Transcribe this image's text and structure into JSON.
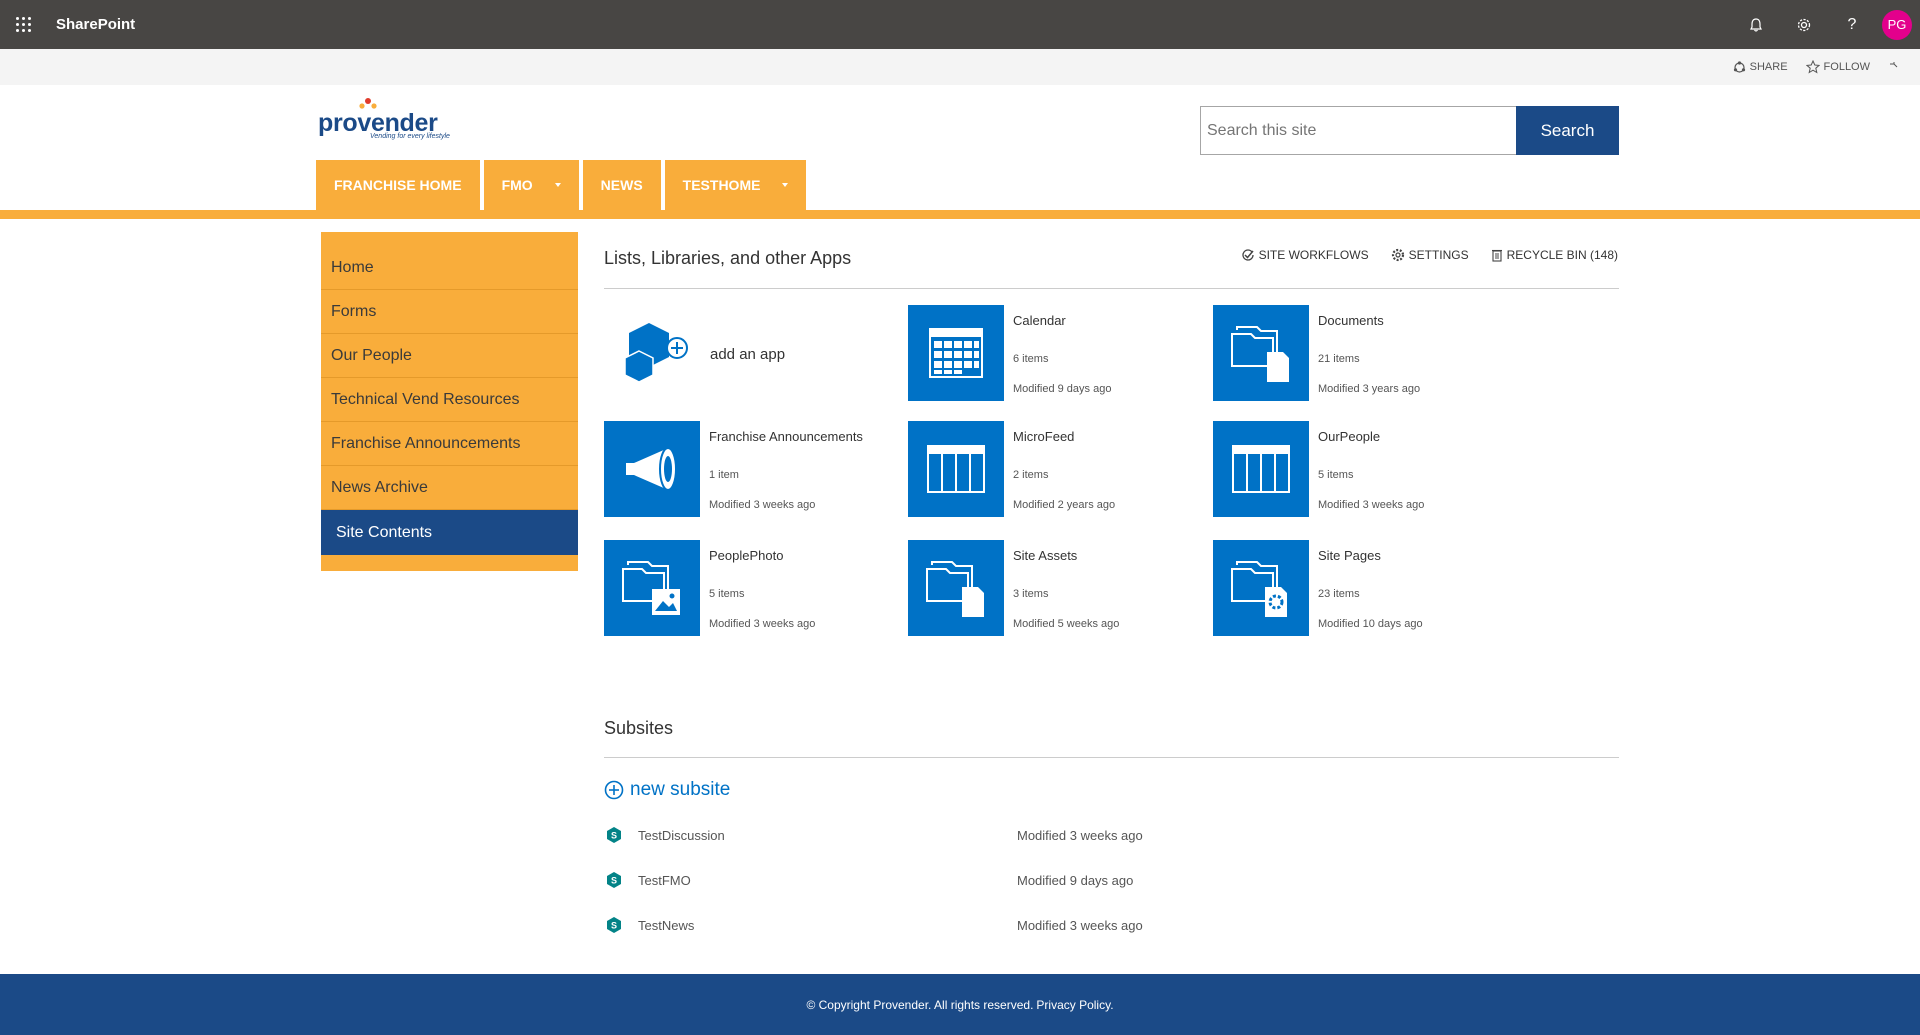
{
  "suitebar": {
    "brand": "SharePoint",
    "avatar_initials": "PG",
    "avatar_color": "#e3008c"
  },
  "actionbar": {
    "share": "SHARE",
    "follow": "FOLLOW"
  },
  "header": {
    "logo_text": "provender",
    "logo_tagline": "Vending for every lifestyle",
    "search_placeholder": "Search this site",
    "search_button": "Search"
  },
  "topnav": [
    {
      "label": "FRANCHISE HOME",
      "has_dropdown": false
    },
    {
      "label": "FMO",
      "has_dropdown": true
    },
    {
      "label": "NEWS",
      "has_dropdown": false
    },
    {
      "label": "TESTHOME",
      "has_dropdown": true
    }
  ],
  "leftnav": [
    {
      "label": "Home"
    },
    {
      "label": "Forms"
    },
    {
      "label": "Our People"
    },
    {
      "label": "Technical Vend Resources"
    },
    {
      "label": "Franchise Announcements"
    },
    {
      "label": "News Archive"
    },
    {
      "label": "Site Contents",
      "selected": true
    }
  ],
  "main": {
    "title": "Lists, Libraries, and other Apps",
    "site_workflows": "SITE WORKFLOWS",
    "settings": "SETTINGS",
    "recycle_bin": "RECYCLE BIN (148)",
    "add_app": "add an app",
    "tiles": [
      {
        "name": "Calendar",
        "count": "6 items",
        "modified": "Modified 9 days ago",
        "icon": "calendar-icon"
      },
      {
        "name": "Documents",
        "count": "21 items",
        "modified": "Modified 3 years ago",
        "icon": "document-library-icon"
      },
      {
        "name": "Franchise Announcements",
        "count": "1 item",
        "modified": "Modified 3 weeks ago",
        "icon": "megaphone-icon"
      },
      {
        "name": "MicroFeed",
        "count": "2 items",
        "modified": "Modified 2 years ago",
        "icon": "list-icon"
      },
      {
        "name": "OurPeople",
        "count": "5 items",
        "modified": "Modified 3 weeks ago",
        "icon": "list-icon"
      },
      {
        "name": "PeoplePhoto",
        "count": "5 items",
        "modified": "Modified 3 weeks ago",
        "icon": "picture-library-icon"
      },
      {
        "name": "Site Assets",
        "count": "3 items",
        "modified": "Modified 5 weeks ago",
        "icon": "document-library-icon"
      },
      {
        "name": "Site Pages",
        "count": "23 items",
        "modified": "Modified 10 days ago",
        "icon": "site-pages-icon"
      }
    ]
  },
  "subsites": {
    "title": "Subsites",
    "new_subsite": "new subsite",
    "items": [
      {
        "name": "TestDiscussion",
        "modified": "Modified 3 weeks ago"
      },
      {
        "name": "TestFMO",
        "modified": "Modified 9 days ago"
      },
      {
        "name": "TestNews",
        "modified": "Modified 3 weeks ago"
      }
    ]
  },
  "footer": {
    "copyright": "© Copyright Provender. All rights reserved.",
    "privacy": "Privacy Policy."
  },
  "colors": {
    "accent_orange": "#f9ad3b",
    "navy": "#1b4a87",
    "tile_blue": "#0072c6",
    "suitebar": "#484644"
  }
}
